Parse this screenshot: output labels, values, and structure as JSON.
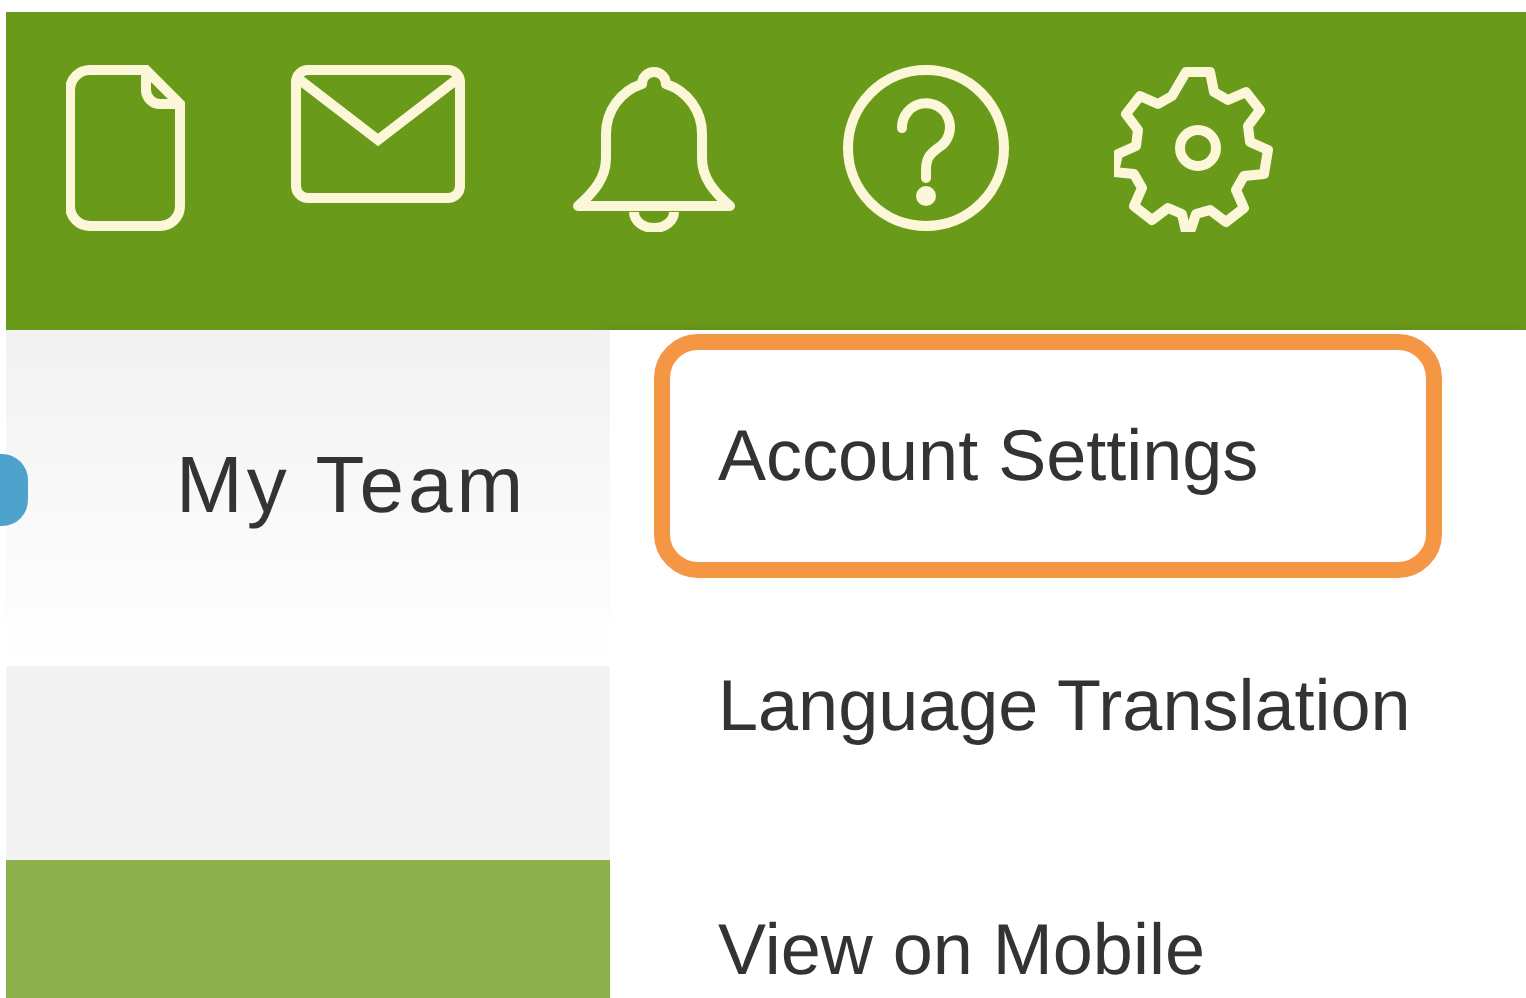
{
  "toolbar": {
    "icons": [
      {
        "kind": "document"
      },
      {
        "kind": "mail"
      },
      {
        "kind": "bell"
      },
      {
        "kind": "help"
      },
      {
        "kind": "gear"
      }
    ]
  },
  "nav": {
    "label": "My Team"
  },
  "menu": {
    "items": [
      {
        "label": "Account Settings",
        "highlighted": true
      },
      {
        "label": "Language Translation",
        "highlighted": false
      },
      {
        "label": "View on Mobile",
        "highlighted": false
      }
    ]
  }
}
